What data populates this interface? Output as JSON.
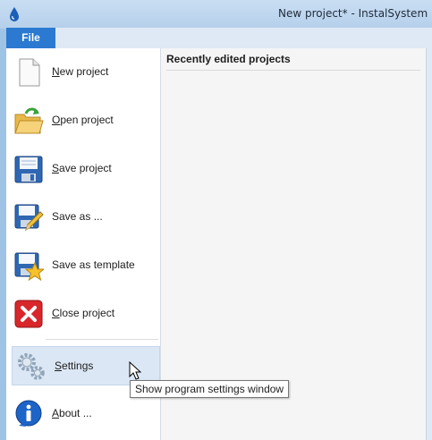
{
  "window": {
    "title": "New project* - InstalSystem Mar"
  },
  "ribbon": {
    "file_tab": "File"
  },
  "menu": {
    "items": [
      {
        "id": "new",
        "label": "New project",
        "icon": "new-document-icon"
      },
      {
        "id": "open",
        "label": "Open project",
        "icon": "open-folder-icon"
      },
      {
        "id": "save",
        "label": "Save project",
        "icon": "floppy-disk-icon"
      },
      {
        "id": "saveas",
        "label": "Save as ...",
        "icon": "floppy-pencil-icon"
      },
      {
        "id": "template",
        "label": "Save as template",
        "icon": "floppy-star-icon"
      },
      {
        "id": "close",
        "label": "Close project",
        "icon": "close-red-icon"
      },
      {
        "id": "settings",
        "label": "Settings",
        "icon": "gears-icon"
      },
      {
        "id": "about",
        "label": "About ...",
        "icon": "info-icon"
      }
    ]
  },
  "recent": {
    "header": "Recently edited projects"
  },
  "tooltip": {
    "text": "Show program settings window"
  },
  "colors": {
    "file_tab": "#2b79d0",
    "hover": "#dbe7f4",
    "close_red": "#d9262b",
    "info_blue": "#1d64c8"
  }
}
